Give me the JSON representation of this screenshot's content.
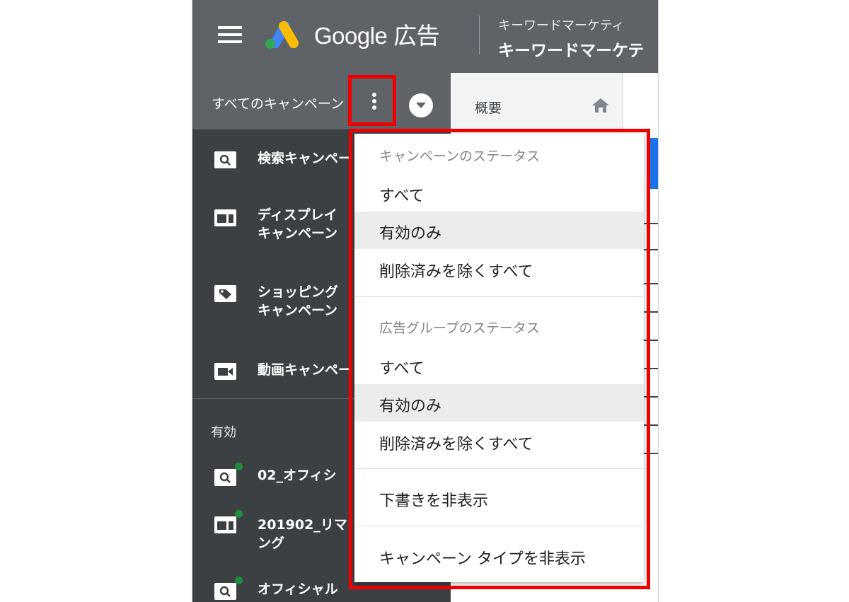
{
  "header": {
    "product_name": "Google 広告",
    "account_subtitle": "キーワードマーケティ",
    "account_name": "キーワードマーケテ"
  },
  "campaign_bar": {
    "label": "すべてのキャンペーン"
  },
  "page_tab": {
    "label": "概要"
  },
  "sidebar": {
    "campaign_types": [
      {
        "label": "検索キャンペー",
        "icon": "search-campaign-icon"
      },
      {
        "label": "ディスプレイ\nキャンペーン",
        "icon": "display-campaign-icon"
      },
      {
        "label": "ショッピング\nキャンペーン",
        "icon": "shopping-tag-icon"
      },
      {
        "label": "動画キャンペー",
        "icon": "video-campaign-icon"
      }
    ],
    "section_label": "有効",
    "campaigns": [
      {
        "label": "02_オフィシ",
        "icon": "search-campaign-icon",
        "status_color": "#1e8e3e"
      },
      {
        "label": "201902_リマ\nング",
        "icon": "display-campaign-icon",
        "status_color": "#1e8e3e"
      },
      {
        "label": "オフィシャル",
        "icon": "search-campaign-icon",
        "status_color": "#1e8e3e"
      }
    ]
  },
  "dropdown": {
    "campaign_status": {
      "heading": "キャンペーンのステータス",
      "options": [
        "すべて",
        "有効のみ",
        "削除済みを除くすべて"
      ],
      "selected": "有効のみ"
    },
    "ad_group_status": {
      "heading": "広告グループのステータス",
      "options": [
        "すべて",
        "有効のみ",
        "削除済みを除くすべて"
      ],
      "selected": "有効のみ"
    },
    "hide_drafts": "下書きを非表示",
    "hide_campaign_types": "キャンペーン タイプを非表示"
  },
  "colors": {
    "header_bg": "#5f6368",
    "sidebar_bg": "#3c4043",
    "highlight": "#ee0000",
    "active_dot": "#1e8e3e",
    "selected_row": "#ececec"
  }
}
